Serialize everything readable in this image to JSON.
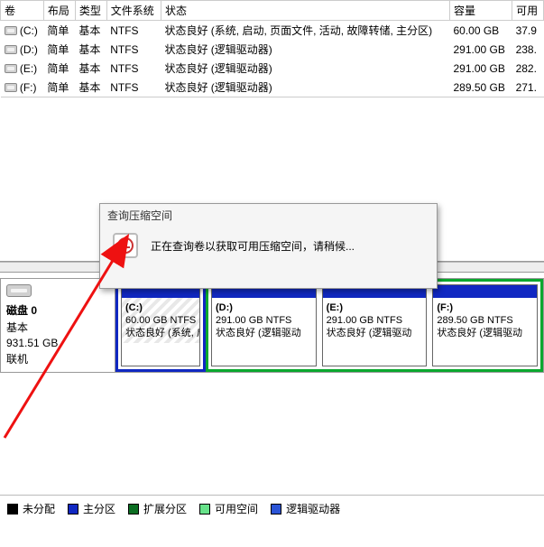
{
  "columns": [
    "卷",
    "布局",
    "类型",
    "文件系统",
    "状态",
    "容量",
    "可用"
  ],
  "volumes": [
    {
      "name": "(C:)",
      "layout": "简单",
      "type": "基本",
      "fs": "NTFS",
      "status": "状态良好 (系统, 启动, 页面文件, 活动, 故障转储, 主分区)",
      "capacity": "60.00 GB",
      "free": "37.9"
    },
    {
      "name": "(D:)",
      "layout": "简单",
      "type": "基本",
      "fs": "NTFS",
      "status": "状态良好 (逻辑驱动器)",
      "capacity": "291.00 GB",
      "free": "238."
    },
    {
      "name": "(E:)",
      "layout": "简单",
      "type": "基本",
      "fs": "NTFS",
      "status": "状态良好 (逻辑驱动器)",
      "capacity": "291.00 GB",
      "free": "282."
    },
    {
      "name": "(F:)",
      "layout": "简单",
      "type": "基本",
      "fs": "NTFS",
      "status": "状态良好 (逻辑驱动器)",
      "capacity": "289.50 GB",
      "free": "271."
    }
  ],
  "disk": {
    "label": "磁盘 0",
    "basic": "基本",
    "size": "931.51 GB",
    "online": "联机"
  },
  "partitions": [
    {
      "letter": "(C:)",
      "size": "60.00 GB NTFS",
      "status": "状态良好 (系统, 启"
    },
    {
      "letter": "(D:)",
      "size": "291.00 GB NTFS",
      "status": "状态良好 (逻辑驱动"
    },
    {
      "letter": "(E:)",
      "size": "291.00 GB NTFS",
      "status": "状态良好 (逻辑驱动"
    },
    {
      "letter": "(F:)",
      "size": "289.50 GB NTFS",
      "status": "状态良好 (逻辑驱动"
    }
  ],
  "dialog": {
    "title": "查询压缩空间",
    "message": "正在查询卷以获取可用压缩空间，请稍候..."
  },
  "legend": {
    "unalloc": "未分配",
    "primary": "主分区",
    "extended": "扩展分区",
    "available": "可用空间",
    "logical": "逻辑驱动器"
  }
}
